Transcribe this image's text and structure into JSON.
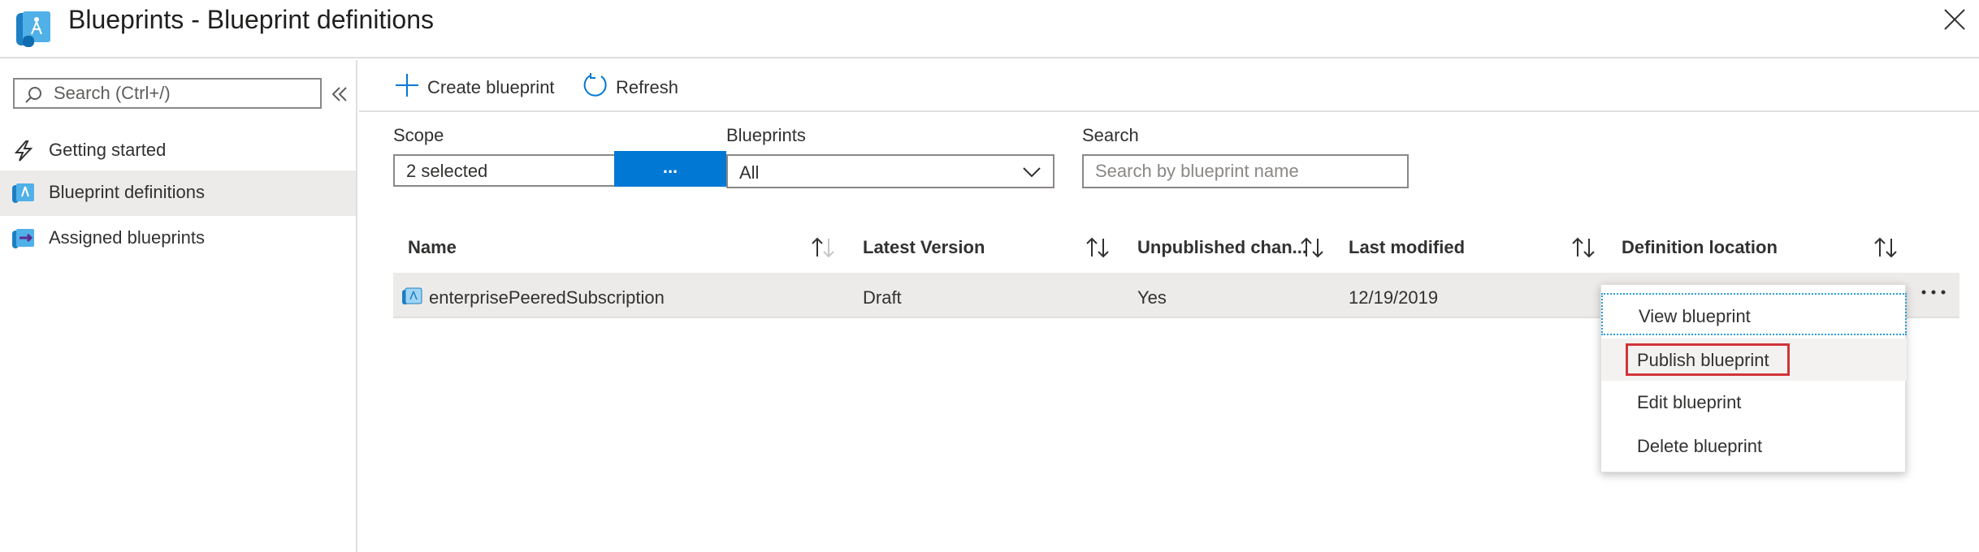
{
  "header": {
    "title": "Blueprints - Blueprint definitions"
  },
  "sidebar": {
    "search_placeholder": "Search (Ctrl+/)",
    "items": [
      {
        "label": "Getting started"
      },
      {
        "label": "Blueprint definitions",
        "active": true
      },
      {
        "label": "Assigned blueprints"
      }
    ]
  },
  "toolbar": {
    "create_label": "Create blueprint",
    "refresh_label": "Refresh"
  },
  "filters": {
    "scope_label": "Scope",
    "scope_value": "2 selected",
    "scope_button": "...",
    "blueprints_label": "Blueprints",
    "blueprints_value": "All",
    "search_label": "Search",
    "search_placeholder": "Search by blueprint name"
  },
  "table": {
    "columns": [
      "Name",
      "Latest Version",
      "Unpublished chan...",
      "Last modified",
      "Definition location"
    ],
    "rows": [
      {
        "name": "enterprisePeeredSubscription",
        "latest_version": "Draft",
        "unpublished_changes": "Yes",
        "last_modified": "12/19/2019",
        "definition_location": ""
      }
    ]
  },
  "context_menu": {
    "items": [
      {
        "label": "View blueprint"
      },
      {
        "label": "Publish blueprint"
      },
      {
        "label": "Edit blueprint"
      },
      {
        "label": "Delete blueprint"
      }
    ]
  },
  "colors": {
    "accent": "#0078d4",
    "highlight": "#d13438",
    "selection_bg": "#edebe9"
  }
}
